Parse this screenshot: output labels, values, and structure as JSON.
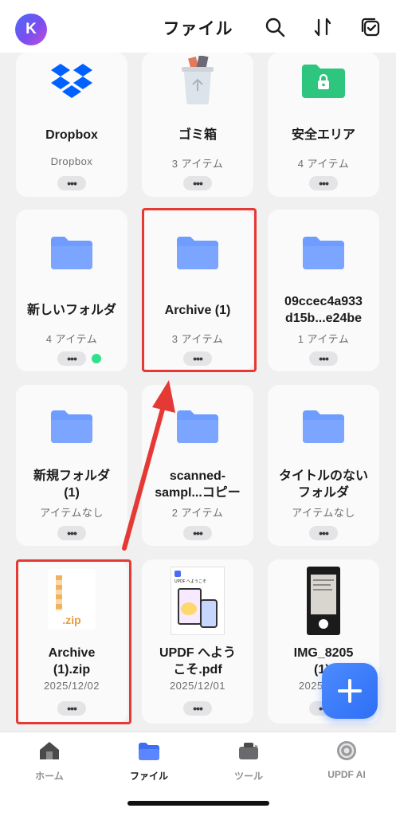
{
  "header": {
    "avatar_initial": "K",
    "title": "ファイル",
    "icons": [
      "search-icon",
      "sort-icon",
      "select-icon"
    ]
  },
  "tiles": [
    {
      "name": "Dropbox",
      "meta": "Dropbox",
      "type": "dropbox"
    },
    {
      "name": "ゴミ箱",
      "meta": "3 アイテム",
      "type": "trash"
    },
    {
      "name": "安全エリア",
      "meta": "4 アイテム",
      "type": "secure-folder"
    },
    {
      "name": "新しいフォルダ",
      "meta": "4 アイテム",
      "type": "folder",
      "synced": true
    },
    {
      "name": "Archive (1)",
      "meta": "3 アイテム",
      "type": "folder"
    },
    {
      "name_line1": "09ccec4a933",
      "name_line2": "d15b...e24be",
      "meta": "1 アイテム",
      "type": "folder"
    },
    {
      "name_line1": "新規フォルダ",
      "name_line2": "(1)",
      "meta": "アイテムなし",
      "type": "folder"
    },
    {
      "name_line1": "scanned-",
      "name_line2": "sampl...コピー",
      "meta": "2 アイテム",
      "type": "folder"
    },
    {
      "name_line1": "タイトルのない",
      "name_line2": "フォルダ",
      "meta": "アイテムなし",
      "type": "folder"
    },
    {
      "name_line1": "Archive",
      "name_line2": "(1).zip",
      "meta": "2025/12/02",
      "type": "zip",
      "zip_label": ".zip"
    },
    {
      "name_line1": "UPDF へよう",
      "name_line2": "こそ.pdf",
      "meta": "2025/12/01",
      "type": "pdf",
      "pdf_heading": "UPDF へようこそ"
    },
    {
      "name_line1": "IMG_8205",
      "name_line2": "(1).",
      "meta": "2025/12/0",
      "type": "image"
    }
  ],
  "more_label": "•••",
  "fab_icon": "plus-icon",
  "bottom_nav": [
    {
      "label": "ホーム",
      "icon": "home-icon",
      "active": false
    },
    {
      "label": "ファイル",
      "icon": "files-icon",
      "active": true
    },
    {
      "label": "ツール",
      "icon": "tools-icon",
      "active": false
    },
    {
      "label": "UPDF AI",
      "icon": "ai-icon",
      "active": false
    }
  ],
  "colors": {
    "folder": "#6e9cff",
    "secure_folder": "#2ec57f",
    "dropbox": "#0061fe",
    "accent": "#2e6ff5",
    "annotation_red": "#e53935",
    "sync_dot": "#30e08a"
  }
}
